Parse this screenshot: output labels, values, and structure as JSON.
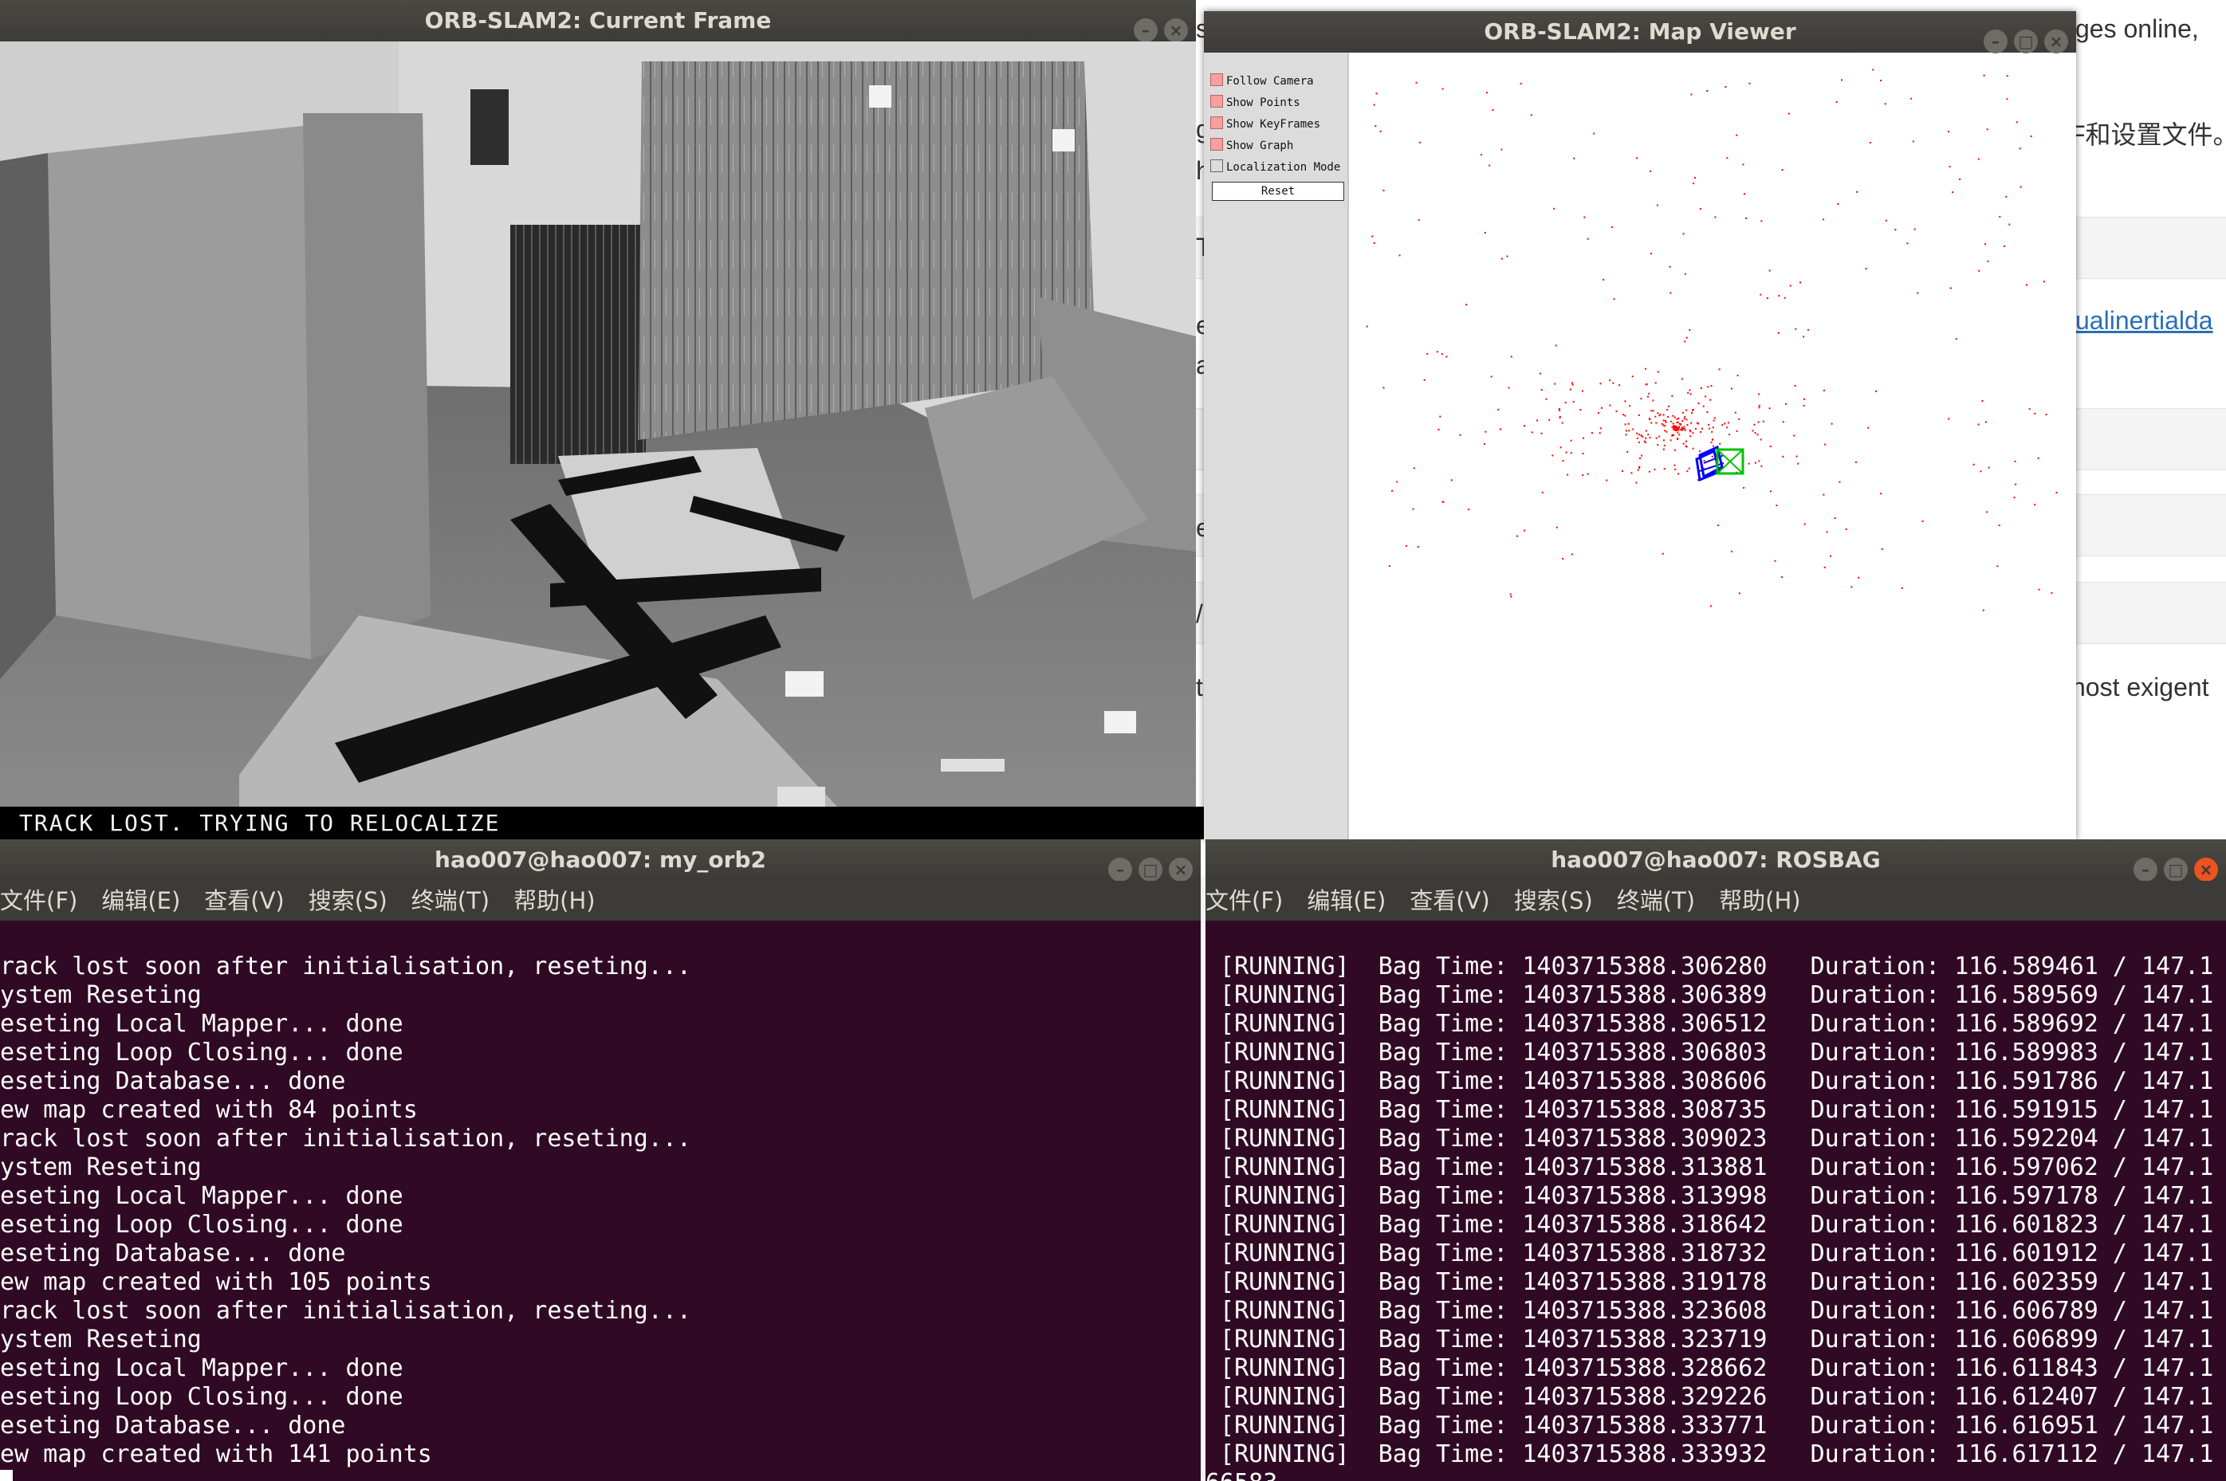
{
  "browser": {
    "snippet_1": "ges online,",
    "snippet_2": "F和设置文件。",
    "snippet_link": "ualinertialda",
    "snippet_3": "nost exigent",
    "edge_chars": [
      "s",
      "g",
      "h",
      "T",
      "e",
      "a",
      "e",
      "/",
      "t"
    ]
  },
  "current_frame": {
    "title": "ORB-SLAM2: Current Frame",
    "status": "TRACK LOST. TRYING TO RELOCALIZE"
  },
  "map_viewer": {
    "title": "ORB-SLAM2: Map Viewer",
    "options": [
      {
        "label": "Follow Camera",
        "checked": true
      },
      {
        "label": "Show Points",
        "checked": true
      },
      {
        "label": "Show KeyFrames",
        "checked": true
      },
      {
        "label": "Show Graph",
        "checked": true
      },
      {
        "label": "Localization Mode",
        "checked": false
      }
    ],
    "reset_label": "Reset",
    "point_color": "#ff0000",
    "keyframe_color": "#0000ff",
    "current_camera_color": "#00c000"
  },
  "terminal_left": {
    "title": "hao007@hao007: my_orb2",
    "menu": [
      "文件(F)",
      "编辑(E)",
      "查看(V)",
      "搜索(S)",
      "终端(T)",
      "帮助(H)"
    ],
    "lines": [
      "rack lost soon after initialisation, reseting...",
      "ystem Reseting",
      "eseting Local Mapper... done",
      "eseting Loop Closing... done",
      "eseting Database... done",
      "ew map created with 84 points",
      "rack lost soon after initialisation, reseting...",
      "ystem Reseting",
      "eseting Local Mapper... done",
      "eseting Loop Closing... done",
      "eseting Database... done",
      "ew map created with 105 points",
      "rack lost soon after initialisation, reseting...",
      "ystem Reseting",
      "eseting Local Mapper... done",
      "eseting Loop Closing... done",
      "eseting Database... done",
      "ew map created with 141 points"
    ]
  },
  "terminal_right": {
    "title": "hao007@hao007: ROSBAG",
    "menu": [
      "文件(F)",
      "编辑(E)",
      "查看(V)",
      "搜索(S)",
      "终端(T)",
      "帮助(H)"
    ],
    "lines": [
      " [RUNNING]  Bag Time: 1403715388.306280   Duration: 116.589461 / 147.1",
      " [RUNNING]  Bag Time: 1403715388.306389   Duration: 116.589569 / 147.1",
      " [RUNNING]  Bag Time: 1403715388.306512   Duration: 116.589692 / 147.1",
      " [RUNNING]  Bag Time: 1403715388.306803   Duration: 116.589983 / 147.1",
      " [RUNNING]  Bag Time: 1403715388.308606   Duration: 116.591786 / 147.1",
      " [RUNNING]  Bag Time: 1403715388.308735   Duration: 116.591915 / 147.1",
      " [RUNNING]  Bag Time: 1403715388.309023   Duration: 116.592204 / 147.1",
      " [RUNNING]  Bag Time: 1403715388.313881   Duration: 116.597062 / 147.1",
      " [RUNNING]  Bag Time: 1403715388.313998   Duration: 116.597178 / 147.1",
      " [RUNNING]  Bag Time: 1403715388.318642   Duration: 116.601823 / 147.1",
      " [RUNNING]  Bag Time: 1403715388.318732   Duration: 116.601912 / 147.1",
      " [RUNNING]  Bag Time: 1403715388.319178   Duration: 116.602359 / 147.1",
      " [RUNNING]  Bag Time: 1403715388.323608   Duration: 116.606789 / 147.1",
      " [RUNNING]  Bag Time: 1403715388.323719   Duration: 116.606899 / 147.1",
      " [RUNNING]  Bag Time: 1403715388.328662   Duration: 116.611843 / 147.1",
      " [RUNNING]  Bag Time: 1403715388.329226   Duration: 116.612407 / 147.1",
      " [RUNNING]  Bag Time: 1403715388.333771   Duration: 116.616951 / 147.1",
      " [RUNNING]  Bag Time: 1403715388.333932   Duration: 116.617112 / 147.1"
    ],
    "trailing_text": "66583"
  }
}
